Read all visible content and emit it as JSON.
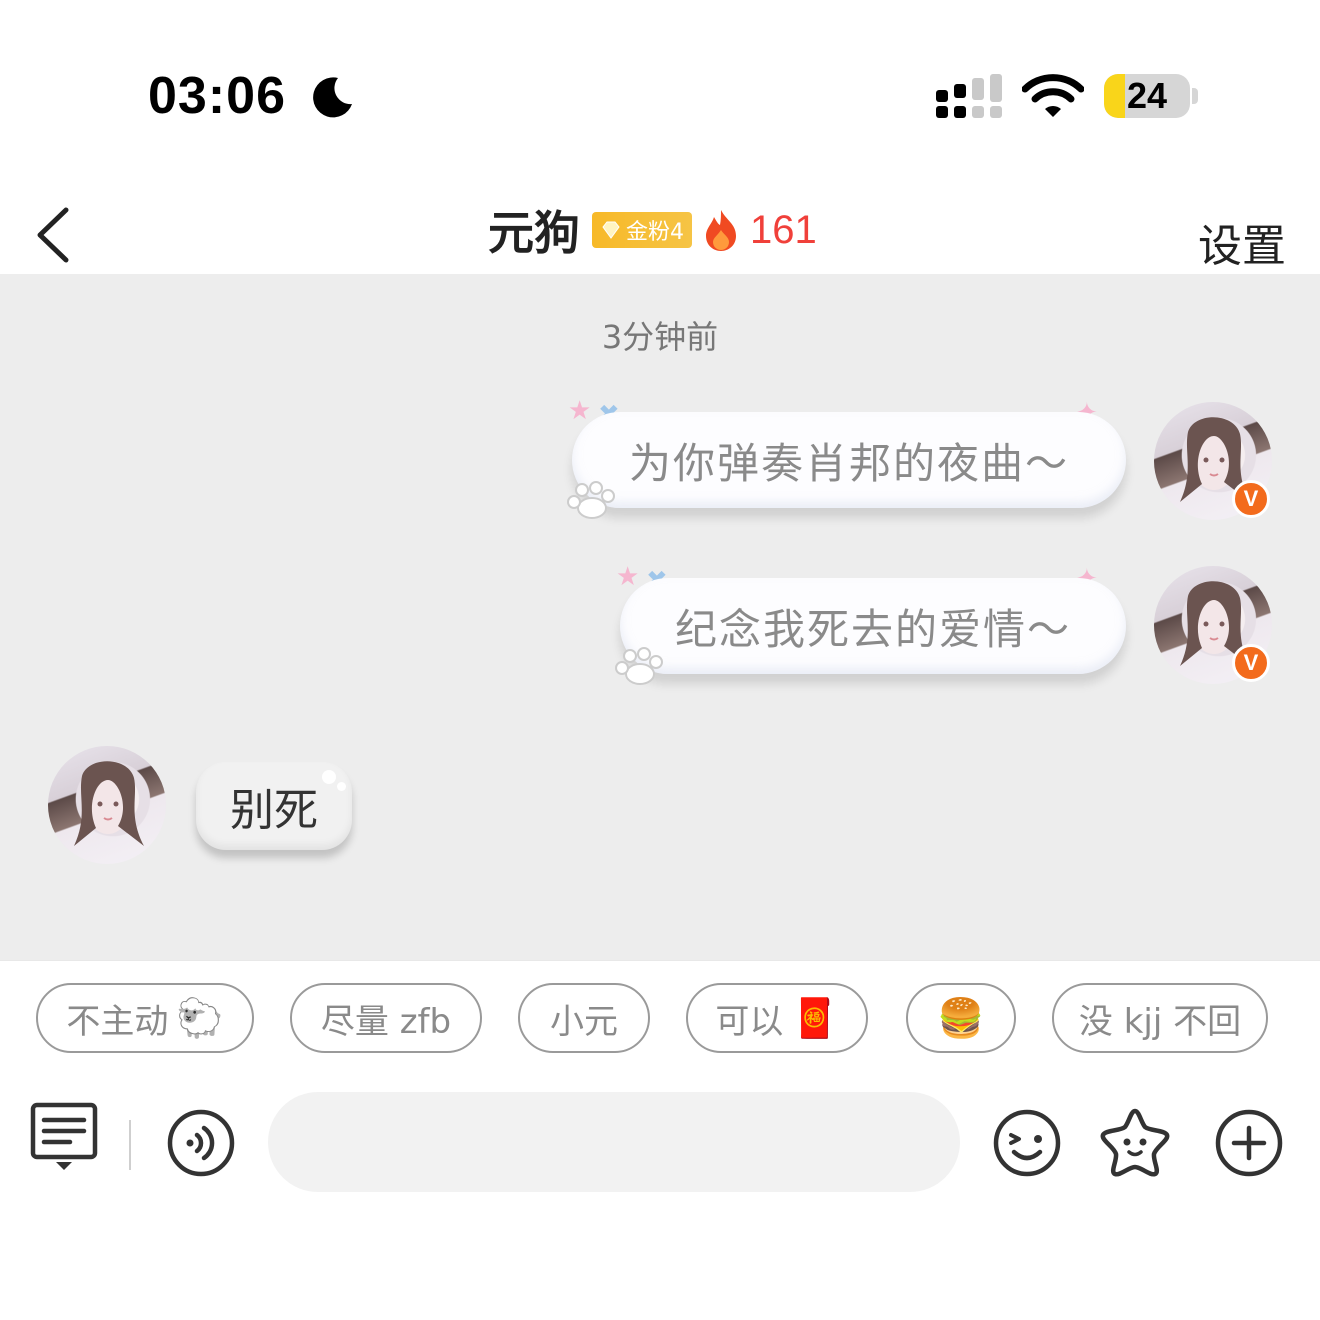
{
  "status_bar": {
    "time": "03:06",
    "battery_level": "24",
    "battery_fraction": 0.24,
    "icons": [
      "moon-icon",
      "signal-icon",
      "wifi-icon",
      "battery-icon"
    ]
  },
  "header": {
    "title": "元狗",
    "fan_badge": "金粉4",
    "heat_count": "161",
    "settings_label": "设置",
    "icons": [
      "back-chevron-icon",
      "gem-icon",
      "flame-icon"
    ]
  },
  "chat": {
    "timestamp": "3分钟前",
    "messages": [
      {
        "side": "right",
        "text": "为你弹奏肖邦的夜曲～",
        "verified": "V"
      },
      {
        "side": "right",
        "text": "纪念我死去的爱情～",
        "verified": "V"
      },
      {
        "side": "left",
        "text": "别死"
      }
    ]
  },
  "quick_replies": [
    {
      "text": "不主动",
      "emoji": "🐑"
    },
    {
      "text": "尽量 zfb",
      "emoji": ""
    },
    {
      "text": "小元",
      "emoji": ""
    },
    {
      "text": "可以",
      "emoji": "🧧"
    },
    {
      "text": "",
      "emoji": "🍔"
    },
    {
      "text": "没 kjj 不回",
      "emoji": ""
    }
  ],
  "input_bar": {
    "placeholder": "",
    "icons": [
      "keyboard-menu-icon",
      "voice-icon",
      "emoji-icon",
      "sticker-star-icon",
      "plus-icon"
    ]
  },
  "colors": {
    "accent_red": "#f0403a",
    "badge_gold": "#f7b928",
    "verified_orange": "#f36b1c",
    "chat_bg": "#ededed"
  }
}
